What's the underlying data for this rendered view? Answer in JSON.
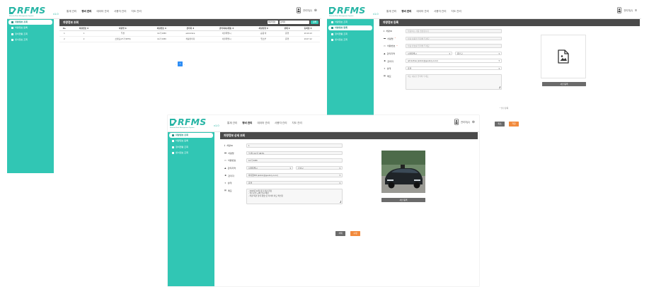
{
  "brand": {
    "name": "RFMS",
    "version": "v1.0",
    "tagline": "Remote Fleet Management System",
    "color": "#31c6b4"
  },
  "nav": [
    "통계 관리",
    "정비 관리",
    "데이터 관리",
    "사용자 관리",
    "지도 관리"
  ],
  "user": {
    "name": "관리자(2)",
    "logout_icon": "exit-icon"
  },
  "sidebar": [
    {
      "label": "차량정보 조회",
      "icon": "list-icon"
    },
    {
      "label": "차량정보 등록",
      "icon": "car-icon"
    },
    {
      "label": "정비현황 조회",
      "icon": "wrench-icon"
    },
    {
      "label": "센서정보 조회",
      "icon": "sensor-icon"
    }
  ],
  "list_view": {
    "title": "차량정보 조회",
    "search": {
      "type_option": "차량 번호",
      "placeholder": "검색어",
      "button": "검색"
    },
    "columns": [
      "No.",
      "차량번호 ⇕",
      "차량명 ⇕",
      "차량번호 ⇕",
      "관리자 ⇕",
      "관리회사(계정) ⇕",
      "차량유형 ⇕",
      "상태 ⇕",
      "등록일 ⇕"
    ],
    "rows": [
      [
        "1",
        "1",
        "투싼",
        "12가 3456",
        "admin/kca",
        "서울특별시",
        "승용 차",
        "운행",
        "23.10.13"
      ],
      [
        "2",
        "2",
        "쏘렌토(27가 9876)",
        "12가 3456",
        "차량관리자",
        "서울특별시",
        "업소부",
        "운행",
        "23.07.12"
      ]
    ],
    "page": "1"
  },
  "register_view": {
    "title": "차량정보 등록",
    "labels": {
      "id": "차량ID",
      "number": "차량명",
      "plate": "차량번호",
      "region": "관리지역",
      "manager": "관리자",
      "status": "상태",
      "memo": "메모"
    },
    "placeholders": {
      "id": "차량ID는 자동 생성됩니다",
      "number": "차량 이름을 입력해 주세요",
      "plate": "차량 번호를 입력해 주세요",
      "memo": "메모 내용을 입력해 주세요"
    },
    "values": {
      "region": "서울특별시",
      "district": "종로구",
      "manager": "admin/bas (admin@geodory.co.kr)",
      "status": "운행"
    },
    "photo_button": "사진 등록",
    "required_note": "* 필수항목",
    "cancel": "취소",
    "save": "저장"
  },
  "detail_view": {
    "title": "차량정보 상세 조회",
    "labels": {
      "id": "차량ID",
      "number": "차량명",
      "plate": "차량번호",
      "region": "관리지역",
      "manager": "관리자",
      "status": "상태",
      "memo": "메모"
    },
    "values": {
      "id": "1",
      "number": "쏘렌토(27가 9876)",
      "plate": "12가 3456",
      "region": "서울특별시",
      "district": "강서구",
      "manager": "박지영PM (admin@geodory.co.kr)",
      "status": "운행"
    },
    "memo_lines": [
      "- 2023년 11월 정기 점검 완료",
      "- 엔진오일 교체 필요 예정",
      "- 차량 외관 상태 양호 및 타이어 마모 확인함"
    ],
    "photo_button": "사진 등록",
    "delete": "삭제",
    "edit": "수정"
  }
}
